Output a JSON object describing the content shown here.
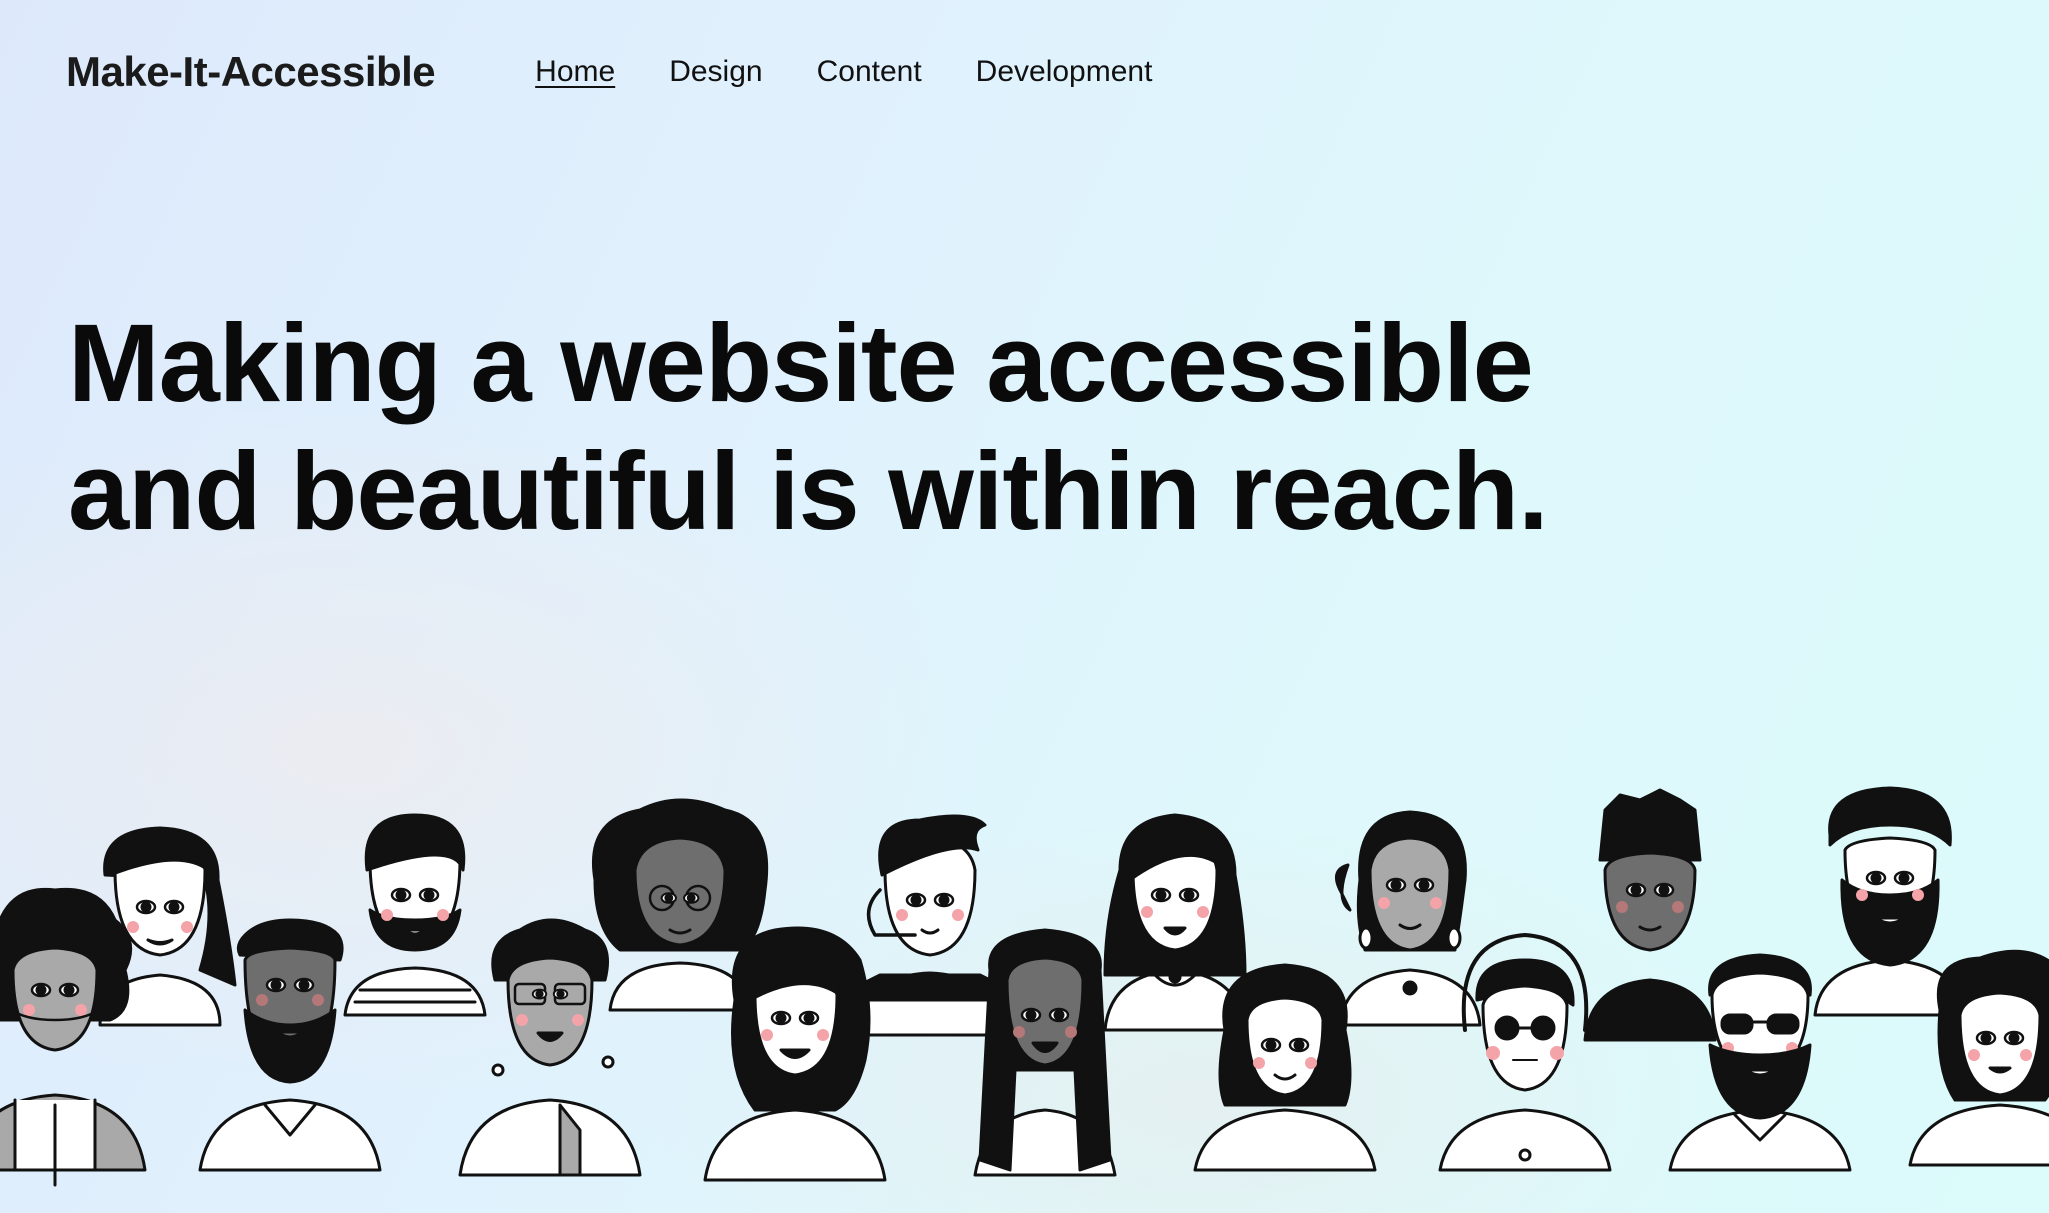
{
  "brand": {
    "name": "Make-It-Accessible"
  },
  "nav": {
    "items": [
      {
        "label": "Home",
        "active": true
      },
      {
        "label": "Design",
        "active": false
      },
      {
        "label": "Content",
        "active": false
      },
      {
        "label": "Development",
        "active": false
      }
    ]
  },
  "hero": {
    "line1": "Making a website accessible",
    "line2": "and beautiful is within reach."
  },
  "colors": {
    "text": "#0a0a0a",
    "blush": "#f4a3a8",
    "skin_mid": "#a9a9a9",
    "skin_dark": "#6e6e6e"
  },
  "illustration": {
    "name": "diverse-people-illustration"
  }
}
